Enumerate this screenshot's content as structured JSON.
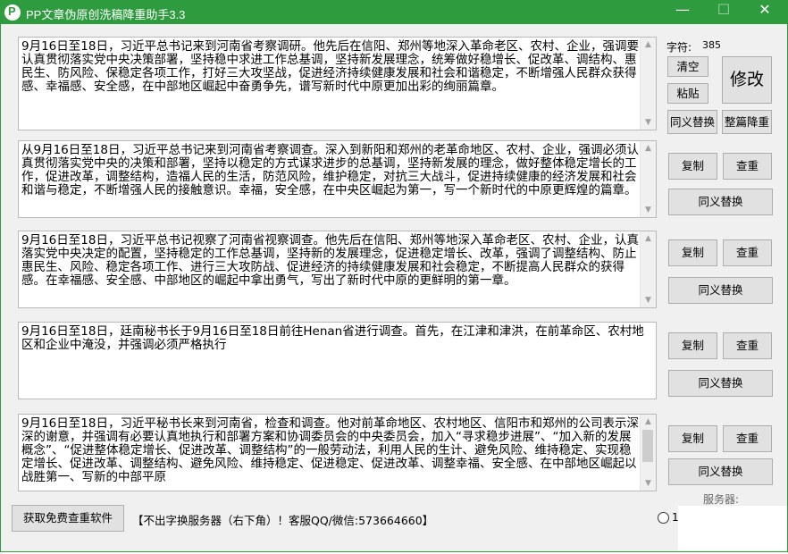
{
  "window": {
    "title": "PP文章伪原创洗稿降重助手3.3",
    "min_icon": "minimize-icon",
    "max_icon": "maximize-icon",
    "close_icon": "close-icon"
  },
  "input": {
    "text": "9月16日至18日，习近平总书记来到河南省考察调研。他先后在信阳、郑州等地深入革命老区、农村、企业，强调要认真贯彻落实党中央决策部署，坚持稳中求进工作总基调，坚持新发展理念，统筹做好稳增长、促改革、调结构、惠民生、防风险、保稳定各项工作，打好三大攻坚战，促进经济持续健康发展和社会和谐稳定，不断增强人民群众获得感、幸福感、安全感，在中部地区崛起中奋勇争先，谱写新时代中原更加出彩的绚丽篇章。",
    "char_count_label": "字符:",
    "char_count": "385",
    "clear_label": "清空",
    "paste_label": "粘贴",
    "modify_label": "修改",
    "synonym_label": "同义替换",
    "full_rewrite_label": "整篇降重"
  },
  "results": [
    {
      "text": "从9月16日至18日，习近平总书记来到河南省考察调查。深入到新阳和郑州的老革命地区、农村、企业，强调必须认真贯彻落实党中央的决策和部署，坚持以稳定的方式谋求进步的总基调，坚持新发展的理念，做好整体稳定增长的工作，促进改革，调整结构，造福人民的生活，防范风险，维护稳定，对抗三大战斗，促进持续健康的经济发展和社会和谐与稳定，不断增强人民的接触意识。幸福，安全感，在中央区崛起为第一，写一个新时代的中原更辉煌的篇章。",
      "copy_label": "复制",
      "check_label": "查重",
      "synonym_label": "同义替换"
    },
    {
      "text": "9月16日至18日，习近平总书记视察了河南省视察调查。他先后在信阳、郑州等地深入革命老区、农村、企业，认真落实党中央决定的配置，坚持稳定的工作总基调，坚持新的发展理念，促进稳定增长、改革，强调了调整结构、防止惠民生、风险、稳定各项工作、进行三大攻防战、促进经济的持续健康发展和社会稳定，不断提高人民群众的获得感。在幸福感、安全感、中部地区的崛起中拿出勇气，写出了新时代中原的更鲜明的第一章。",
      "copy_label": "复制",
      "check_label": "查重",
      "synonym_label": "同义替换"
    },
    {
      "text": "9月16日至18日，廷南秘书长于9月16日至18日前往Henan省进行调查。首先，在江津和津洪，在前革命区、农村地区和企业中淹没，并强调必须严格执行",
      "copy_label": "复制",
      "check_label": "查重",
      "synonym_label": "同义替换"
    },
    {
      "text": "9月16日至18日，习近平秘书长来到河南省，检查和调查。他对前革命地区、农村地区、信阳市和郑州的公司表示深深的谢意，并强调有必要认真地执行和部署方案和协调委员会的中央委员会，加入“寻求稳步进展”、“加入新的发展概念”、“促进整体稳定增长、促进改革、调整结构”的一般劳动法，利用人民的生计、避免风险、维持稳定、实现稳定增长、促进改革、调整结构、避免风险、维持稳定、促进稳定、促进改革、调整幸福、安全感、在中部地区崛起以战胜第一、写新的中部平原",
      "copy_label": "复制",
      "check_label": "查重",
      "synonym_label": "同义替换"
    }
  ],
  "footer": {
    "get_software_label": "获取免费查重软件",
    "notice": "【不出字换服务器（右下角）！客服QQ/微信:573664660】",
    "server_label": "服务器:",
    "server_option": "1"
  }
}
